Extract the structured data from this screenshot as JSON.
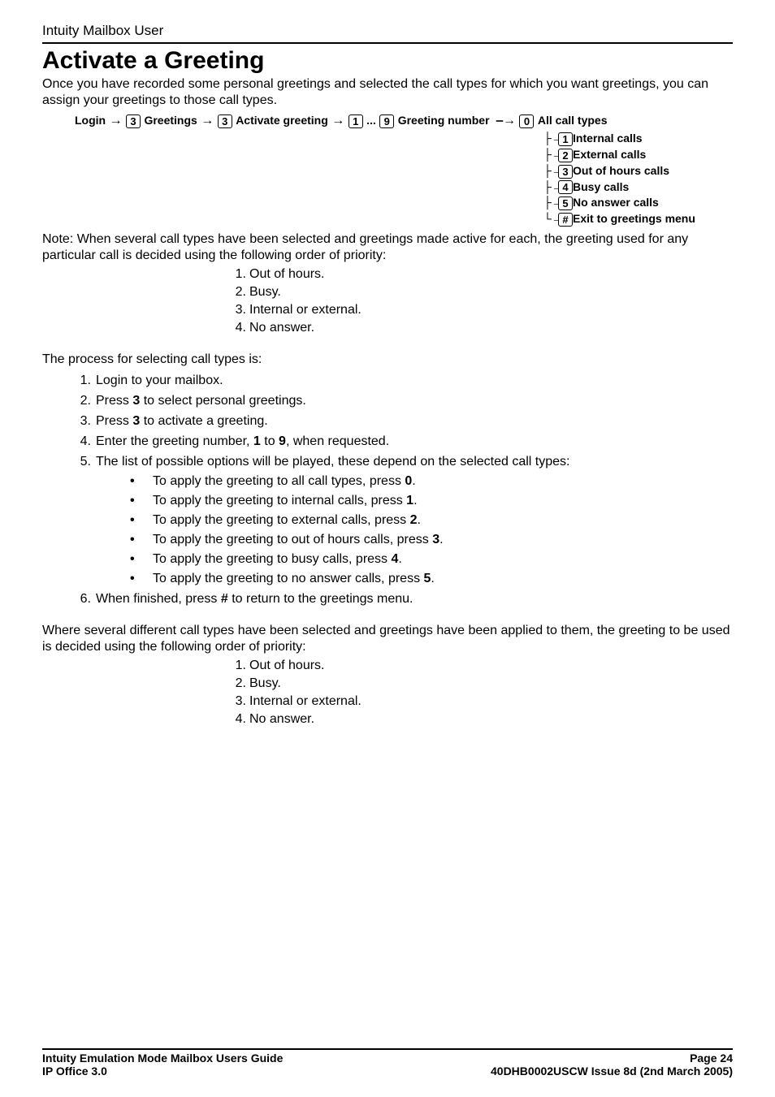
{
  "header": {
    "title": "Intuity Mailbox User"
  },
  "section": {
    "heading": "Activate a Greeting"
  },
  "intro": "Once you have recorded some personal greetings and selected the call types for which you want greetings, you can assign your greetings to those call types.",
  "flow": {
    "login": "Login",
    "greetings_key": "3",
    "greetings_label": "Greetings",
    "activate_key": "3",
    "activate_label": "Activate greeting",
    "range_start": "1",
    "range_ellipsis": "...",
    "range_end": "9",
    "number_label": "Greeting number",
    "options": [
      {
        "key": "0",
        "label": "All call types"
      },
      {
        "key": "1",
        "label": "Internal calls"
      },
      {
        "key": "2",
        "label": "External calls"
      },
      {
        "key": "3",
        "label": "Out of hours calls"
      },
      {
        "key": "4",
        "label": "Busy calls"
      },
      {
        "key": "5",
        "label": "No answer calls"
      },
      {
        "key": "#",
        "label": "Exit to greetings menu"
      }
    ]
  },
  "note": "Note: When several call types have been selected and greetings made active for each, the greeting used for any particular call is decided using the following order of priority:",
  "priority1": [
    "Out of hours.",
    "Busy.",
    "Internal or external.",
    "No answer."
  ],
  "process_intro": "The process for selecting call types is:",
  "steps": {
    "s1": "Login to your mailbox.",
    "s2a": "Press ",
    "s2b": "3",
    "s2c": " to select personal greetings.",
    "s3a": "Press ",
    "s3b": "3",
    "s3c": " to activate a greeting.",
    "s4a": "Enter the greeting number, ",
    "s4b": "1",
    "s4c": " to ",
    "s4d": "9",
    "s4e": ", when requested.",
    "s5": "The list of possible options will be played, these depend on the selected call types:",
    "s6a": "When finished, press ",
    "s6b": "#",
    "s6c": " to return to the greetings menu."
  },
  "suboptions": {
    "a1": "To apply the greeting to all call types, press ",
    "a2": "0",
    "a3": ".",
    "b1": "To apply the greeting to internal calls, press ",
    "b2": "1",
    "b3": ".",
    "c1": "To apply the greeting to external calls, press ",
    "c2": "2",
    "c3": ".",
    "d1": "To apply the greeting to out of hours calls, press ",
    "d2": "3",
    "d3": ".",
    "e1": "To apply the greeting to busy calls, press ",
    "e2": "4",
    "e3": ".",
    "f1": "To apply the greeting to no answer calls, press ",
    "f2": "5",
    "f3": "."
  },
  "closing": "Where several different call types have been selected and greetings have been applied to them, the greeting to be used is decided using the following order of priority:",
  "priority2": [
    "Out of hours.",
    "Busy.",
    "Internal or external.",
    "No answer."
  ],
  "footer": {
    "left1": "Intuity Emulation Mode Mailbox Users Guide",
    "right1": "Page 24",
    "left2": "IP Office 3.0",
    "right2": "40DHB0002USCW Issue 8d (2nd March 2005)"
  }
}
